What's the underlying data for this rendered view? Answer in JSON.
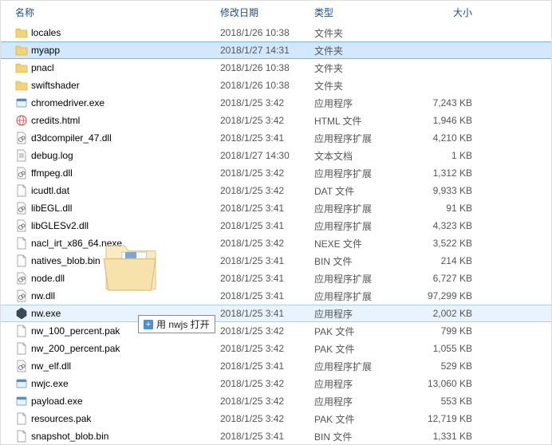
{
  "headers": {
    "name": "名称",
    "date": "修改日期",
    "type": "类型",
    "size": "大小"
  },
  "drag_tip": {
    "plus": "+",
    "text": "用 nwjs 打开"
  },
  "files": [
    {
      "icon": "folder",
      "name": "locales",
      "date": "2018/1/26 10:38",
      "type": "文件夹",
      "size": "",
      "state": ""
    },
    {
      "icon": "folder",
      "name": "myapp",
      "date": "2018/1/27 14:31",
      "type": "文件夹",
      "size": "",
      "state": "selected"
    },
    {
      "icon": "folder",
      "name": "pnacl",
      "date": "2018/1/26 10:38",
      "type": "文件夹",
      "size": "",
      "state": ""
    },
    {
      "icon": "folder",
      "name": "swiftshader",
      "date": "2018/1/26 10:38",
      "type": "文件夹",
      "size": "",
      "state": ""
    },
    {
      "icon": "exe",
      "name": "chromedriver.exe",
      "date": "2018/1/25 3:42",
      "type": "应用程序",
      "size": "7,243 KB",
      "state": ""
    },
    {
      "icon": "html",
      "name": "credits.html",
      "date": "2018/1/25 3:42",
      "type": "HTML 文件",
      "size": "1,946 KB",
      "state": ""
    },
    {
      "icon": "dll",
      "name": "d3dcompiler_47.dll",
      "date": "2018/1/25 3:41",
      "type": "应用程序扩展",
      "size": "4,210 KB",
      "state": ""
    },
    {
      "icon": "txt",
      "name": "debug.log",
      "date": "2018/1/27 14:30",
      "type": "文本文档",
      "size": "1 KB",
      "state": ""
    },
    {
      "icon": "dll",
      "name": "ffmpeg.dll",
      "date": "2018/1/25 3:42",
      "type": "应用程序扩展",
      "size": "1,312 KB",
      "state": ""
    },
    {
      "icon": "file",
      "name": "icudtl.dat",
      "date": "2018/1/25 3:42",
      "type": "DAT 文件",
      "size": "9,933 KB",
      "state": ""
    },
    {
      "icon": "dll",
      "name": "libEGL.dll",
      "date": "2018/1/25 3:41",
      "type": "应用程序扩展",
      "size": "91 KB",
      "state": ""
    },
    {
      "icon": "dll",
      "name": "libGLESv2.dll",
      "date": "2018/1/25 3:41",
      "type": "应用程序扩展",
      "size": "4,323 KB",
      "state": ""
    },
    {
      "icon": "file",
      "name": "nacl_irt_x86_64.nexe",
      "date": "2018/1/25 3:42",
      "type": "NEXE 文件",
      "size": "3,522 KB",
      "state": ""
    },
    {
      "icon": "file",
      "name": "natives_blob.bin",
      "date": "2018/1/25 3:41",
      "type": "BIN 文件",
      "size": "214 KB",
      "state": ""
    },
    {
      "icon": "dll",
      "name": "node.dll",
      "date": "2018/1/25 3:41",
      "type": "应用程序扩展",
      "size": "6,727 KB",
      "state": ""
    },
    {
      "icon": "dll",
      "name": "nw.dll",
      "date": "2018/1/25 3:41",
      "type": "应用程序扩展",
      "size": "97,299 KB",
      "state": ""
    },
    {
      "icon": "nwexe",
      "name": "nw.exe",
      "date": "2018/1/25 3:41",
      "type": "应用程序",
      "size": "2,002 KB",
      "state": "secondary"
    },
    {
      "icon": "file",
      "name": "nw_100_percent.pak",
      "date": "2018/1/25 3:42",
      "type": "PAK 文件",
      "size": "799 KB",
      "state": ""
    },
    {
      "icon": "file",
      "name": "nw_200_percent.pak",
      "date": "2018/1/25 3:42",
      "type": "PAK 文件",
      "size": "1,055 KB",
      "state": ""
    },
    {
      "icon": "dll",
      "name": "nw_elf.dll",
      "date": "2018/1/25 3:41",
      "type": "应用程序扩展",
      "size": "529 KB",
      "state": ""
    },
    {
      "icon": "exe",
      "name": "nwjc.exe",
      "date": "2018/1/25 3:42",
      "type": "应用程序",
      "size": "13,060 KB",
      "state": ""
    },
    {
      "icon": "exe",
      "name": "payload.exe",
      "date": "2018/1/25 3:42",
      "type": "应用程序",
      "size": "553 KB",
      "state": ""
    },
    {
      "icon": "file",
      "name": "resources.pak",
      "date": "2018/1/25 3:42",
      "type": "PAK 文件",
      "size": "12,719 KB",
      "state": ""
    },
    {
      "icon": "file",
      "name": "snapshot_blob.bin",
      "date": "2018/1/25 3:41",
      "type": "BIN 文件",
      "size": "1,331 KB",
      "state": ""
    }
  ]
}
